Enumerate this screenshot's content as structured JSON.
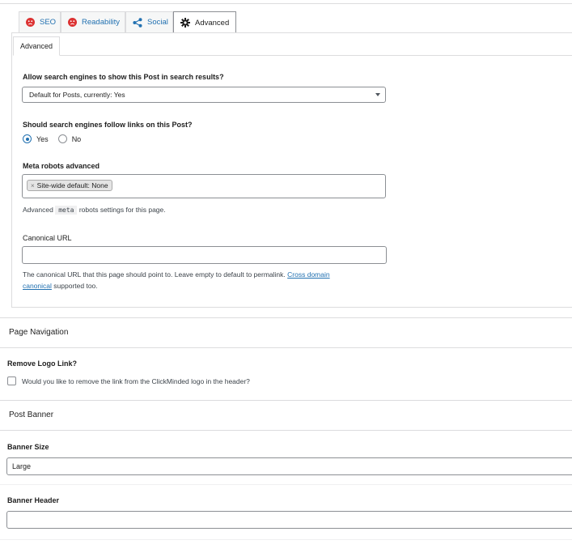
{
  "tabs": [
    {
      "label": "SEO",
      "icon": "sad-face-icon"
    },
    {
      "label": "Readability",
      "icon": "sad-face-icon"
    },
    {
      "label": "Social",
      "icon": "share-icon"
    },
    {
      "label": "Advanced",
      "icon": "gear-icon"
    }
  ],
  "subtab": {
    "label": "Advanced"
  },
  "advanced": {
    "search_visibility_label": "Allow search engines to show this Post in search results?",
    "search_visibility_value": "Default for Posts, currently: Yes",
    "follow_links_label": "Should search engines follow links on this Post?",
    "follow_yes": "Yes",
    "follow_no": "No",
    "follow_selected": "Yes",
    "meta_robots_label": "Meta robots advanced",
    "meta_robots_chip_x": "×",
    "meta_robots_chip": "Site-wide default: None",
    "meta_robots_help_before": "Advanced",
    "meta_robots_help_code": "meta",
    "meta_robots_help_after": "robots settings for this page.",
    "canonical_label": "Canonical URL",
    "canonical_value": "",
    "canonical_help_before": "The canonical URL that this page should point to. Leave empty to default to permalink.",
    "canonical_help_link1": "Cross domain",
    "canonical_help_link2": "canonical",
    "canonical_help_after": "supported too."
  },
  "page_navigation": {
    "title": "Page Navigation",
    "remove_logo_label": "Remove Logo Link?",
    "remove_logo_checkbox": "Would you like to remove the link from the ClickMinded logo in the header?"
  },
  "post_banner": {
    "title": "Post Banner",
    "banner_size_label": "Banner Size",
    "banner_size_value": "Large",
    "banner_header_label": "Banner Header",
    "banner_header_value": ""
  },
  "colors": {
    "accent": "#2271b1",
    "error": "#dc3232",
    "border": "#dcdcde"
  }
}
